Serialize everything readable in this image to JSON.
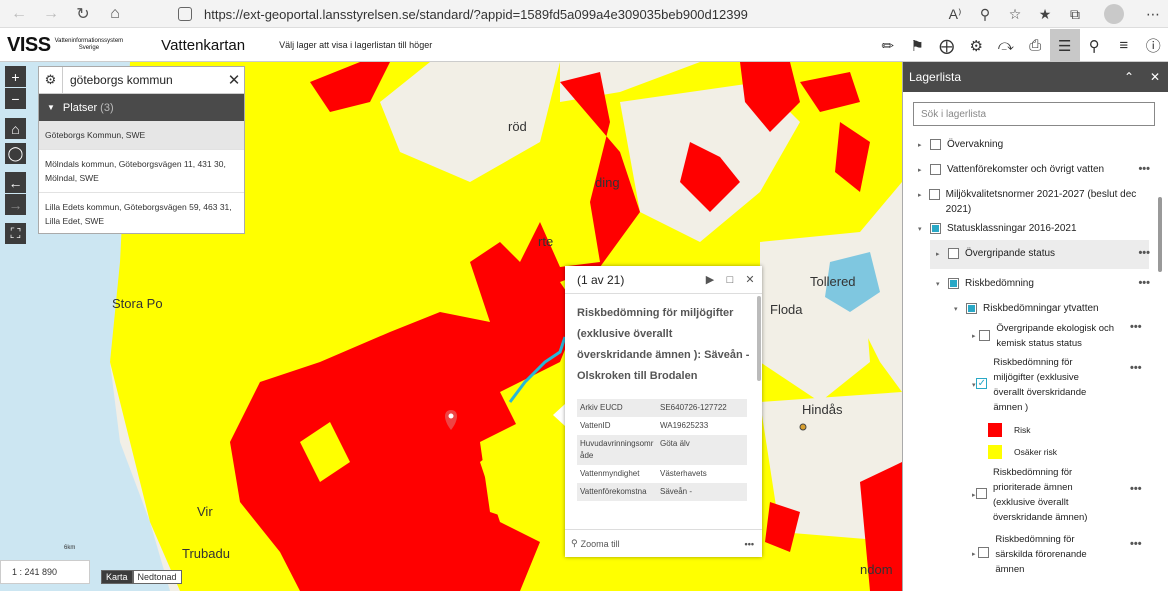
{
  "browser": {
    "url": "https://ext-geoportal.lansstyrelsen.se/standard/?appid=1589fd5a099a4e309035beb900d12399",
    "icons": [
      "back-icon",
      "forward-icon",
      "reload-icon",
      "home-icon",
      "lock-icon",
      "read-aloud-icon",
      "zoom-icon",
      "favorite-add-icon",
      "favorites-icon",
      "collections-icon",
      "profile-avatar",
      "menu-icon"
    ]
  },
  "app": {
    "logo_main": "VISS",
    "logo_sub_1": "Vatteninformationssystem",
    "logo_sub_2": "Sverige",
    "title": "Vattenkartan",
    "hint": "Välj lager att visa i lagerlistan till höger",
    "tools": [
      "ruler-icon",
      "bookmark-icon",
      "coordinate-icon",
      "filter-icon",
      "share-icon",
      "print-icon",
      "layers-icon",
      "search-map-icon",
      "list-icon",
      "info-icon"
    ]
  },
  "map": {
    "labels": [
      {
        "text": "röd"
      },
      {
        "text": "ding"
      },
      {
        "text": "rte"
      },
      {
        "text": "Stora Po"
      },
      {
        "text": "Tollered"
      },
      {
        "text": "Floda"
      },
      {
        "text": "Hindås"
      },
      {
        "text": "Vir"
      },
      {
        "text": "Trubadu"
      },
      {
        "text": "ndom"
      }
    ],
    "colors": {
      "risk": "#ff0000",
      "uncertain": "#ffff00",
      "water": "#cce6f2",
      "land": "#f2efe6"
    }
  },
  "search": {
    "value": "göteborgs kommun",
    "section_label": "Platser",
    "section_count": "(3)",
    "results": [
      {
        "name": "Göteborgs Kommun",
        "suffix": ", SWE"
      },
      {
        "name": "Mölndals kommun, Göteborgsvägen 11, 431 30, Mölndal, SWE",
        "suffix": ""
      },
      {
        "name": "Lilla Edets kommun, Göteborgsvägen 59, 463 31, Lilla Edet, SWE",
        "suffix": ""
      }
    ]
  },
  "popup": {
    "counter": "(1 av 21)",
    "title": "Riskbedömning för miljögifter (exklusive överallt överskridande ämnen ): Säveån - Olskroken till Brodalen",
    "rows": [
      {
        "key": "Arkiv EUCD",
        "value": "SE640726-127722"
      },
      {
        "key": "VattenID",
        "value": "WA19625233"
      },
      {
        "key": "Huvudavrinningsområde",
        "value": "Göta älv"
      },
      {
        "key": "Vattenmyndighet",
        "value": "Västerhavets"
      },
      {
        "key": "Vattenförekomstna",
        "value": "Säveån -"
      }
    ],
    "zoom_label": "Zooma till",
    "more": "•••"
  },
  "scale": {
    "value": "1 : 241 890",
    "bar_label": "6km"
  },
  "basemap": {
    "options": [
      "Karta",
      "Nedtonad"
    ],
    "selected": "Karta"
  },
  "layers": {
    "title": "Lagerlista",
    "search_placeholder": "Sök i lagerlista",
    "items": [
      {
        "label": "Övervakning",
        "state": "unchecked"
      },
      {
        "label": "Vattenförekomster och övrigt vatten",
        "state": "unchecked",
        "more": "•••"
      },
      {
        "label": "Miljökvalitetsnormer 2021-2027 (beslut dec 2021)",
        "state": "unchecked"
      },
      {
        "label": "Statusklassningar 2016-2021",
        "state": "partial"
      },
      {
        "label": "Övergripande status",
        "state": "unchecked",
        "more": "•••"
      },
      {
        "label": "Riskbedömning",
        "state": "partial",
        "more": "•••"
      },
      {
        "label": "Riskbedömningar ytvatten",
        "state": "partial"
      },
      {
        "label": "Övergripande ekologisk och kemisk status status",
        "state": "unchecked",
        "more": "•••"
      },
      {
        "label": "Riskbedömning för miljögifter (exklusive överallt överskridande ämnen )",
        "state": "checked",
        "more": "•••"
      },
      {
        "label": "Risk",
        "swatch": "#ff0000"
      },
      {
        "label": "Osäker risk",
        "swatch": "#ffff00"
      },
      {
        "label": "Riskbedömning för prioriterade ämnen (exklusive överallt överskridande ämnen)",
        "state": "unchecked",
        "more": "•••"
      },
      {
        "label": "Riskbedömning för särskilda förorenande ämnen",
        "state": "unchecked",
        "more": "•••"
      }
    ]
  }
}
